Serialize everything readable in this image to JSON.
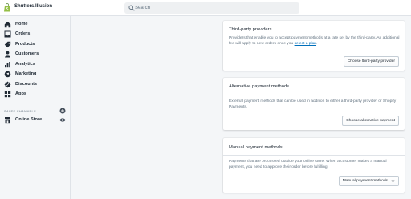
{
  "header": {
    "store_name": "Shutters.Illusion",
    "search_placeholder": "Search"
  },
  "sidebar": {
    "items": [
      {
        "label": "Home",
        "icon": "home-icon"
      },
      {
        "label": "Orders",
        "icon": "orders-icon"
      },
      {
        "label": "Products",
        "icon": "products-icon"
      },
      {
        "label": "Customers",
        "icon": "customers-icon"
      },
      {
        "label": "Analytics",
        "icon": "analytics-icon"
      },
      {
        "label": "Marketing",
        "icon": "marketing-icon"
      },
      {
        "label": "Discounts",
        "icon": "discounts-icon"
      },
      {
        "label": "Apps",
        "icon": "apps-icon"
      }
    ],
    "channels_heading": "SALES CHANNELS",
    "channels": [
      {
        "label": "Online Store",
        "icon": "online-store-icon"
      }
    ]
  },
  "main": {
    "third_party": {
      "title": "Third-party providers",
      "description": "Providers that enable you to accept payment methods at a rate set by the third-party. An additional fee will apply to new orders once you",
      "link_text": "select a plan",
      "button": "Choose third-party provider"
    },
    "alternative": {
      "title": "Alternative payment methods",
      "description": "External payment methods that can be used in addition to either a third-party provider or Shopify Payments.",
      "button": "Choose alternative payment"
    },
    "manual": {
      "title": "Manual payment methods",
      "description": "Payments that are processed outside your online store. When a customer makes a manual payment, you need to approve their order before fulfilling.",
      "button": "Manual payment methods"
    }
  },
  "colors": {
    "brand": "#95bf47",
    "link": "#006fbb",
    "nav_icon": "#212b36"
  }
}
